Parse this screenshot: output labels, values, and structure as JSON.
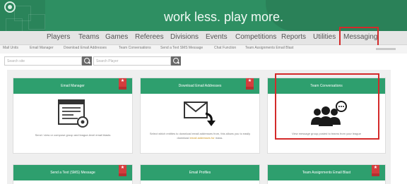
{
  "header": {
    "tagline": "work less. play more."
  },
  "main_nav": {
    "items": [
      {
        "label": "Players"
      },
      {
        "label": "Teams"
      },
      {
        "label": "Games"
      },
      {
        "label": "Referees"
      },
      {
        "label": "Divisions"
      },
      {
        "label": "Events"
      },
      {
        "label": "Competitions"
      },
      {
        "label": "Reports"
      },
      {
        "label": "Utilities"
      },
      {
        "label": "Messaging"
      }
    ],
    "active": "Messaging",
    "highlight_color": "#d42a2a"
  },
  "sub_nav": {
    "items": [
      {
        "label": "Mail Units"
      },
      {
        "label": "Email Manager"
      },
      {
        "label": "Download Email Addresses"
      },
      {
        "label": "Team Conversations"
      },
      {
        "label": "Send a Text SMS Message"
      },
      {
        "label": "Chat Function"
      },
      {
        "label": "Team Assignments Email Blast"
      }
    ]
  },
  "search": {
    "left_placeholder": "Search site",
    "right_placeholder": "Search Player"
  },
  "cards": [
    {
      "title": "Email Manager",
      "badge": "★",
      "icon": "newsletter-icon",
      "description": "Send / view or compose group and league-level email blasts"
    },
    {
      "title": "Download Email Addresses",
      "badge": "★",
      "icon": "envelope-download-icon",
      "description_pre": "Select which entities to download email addresses from, this allows you to easily download ",
      "description_link": "email addresses for",
      "description_post": " mass."
    },
    {
      "title": "Team Conversations",
      "icon": "team-chat-icon",
      "description": "View message group posted to teams from your league"
    },
    {
      "title": "Send a Text (SMS) Message",
      "badge": "★"
    },
    {
      "title": "Email Profiles"
    },
    {
      "title": "Team Assignments Email Blast",
      "badge": "★"
    }
  ],
  "colors": {
    "brand_green": "#2e8f62",
    "card_header": "#2e9f6e",
    "badge_red": "#d43d3d",
    "highlight_red": "#d42a2a"
  }
}
